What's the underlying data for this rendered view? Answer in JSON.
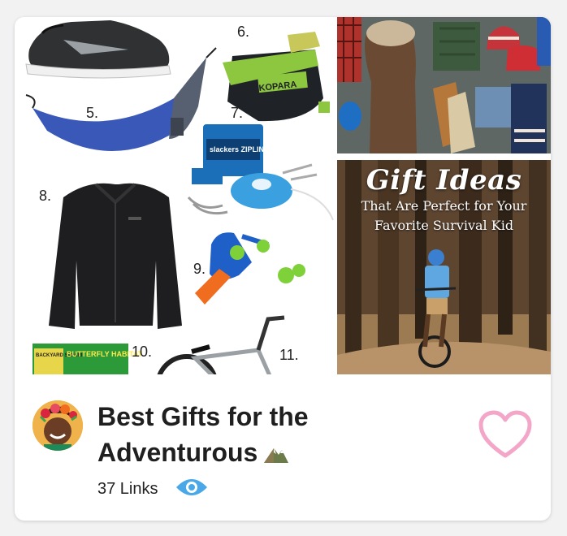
{
  "card": {
    "title_line1": "Best Gifts for the",
    "title_line2": "Adventurous",
    "title_icon": "mountain-icon",
    "links_count": "37 Links",
    "view_icon": "eye-icon",
    "favorite_icon": "heart-outline-icon"
  },
  "collage": {
    "left_labels": [
      "5.",
      "6.",
      "7.",
      "8.",
      "9.",
      "10.",
      "11."
    ],
    "product_text": {
      "slackline_brand": "KOPARA",
      "zipline_box": "slackers ZIPLINE",
      "habitat_box": "BUTTERFLY HABITAT",
      "habitat_small": "BACKYARD SAFARI"
    },
    "overlay": {
      "title": "Gift Ideas",
      "subtitle_line1": "That Are Perfect for Your",
      "subtitle_line2": "Favorite Survival Kid"
    }
  },
  "colors": {
    "heart": "#f3a6c8",
    "eye": "#4aa8e8",
    "title": "#1f1f1f",
    "background": "#f2f2f3"
  }
}
